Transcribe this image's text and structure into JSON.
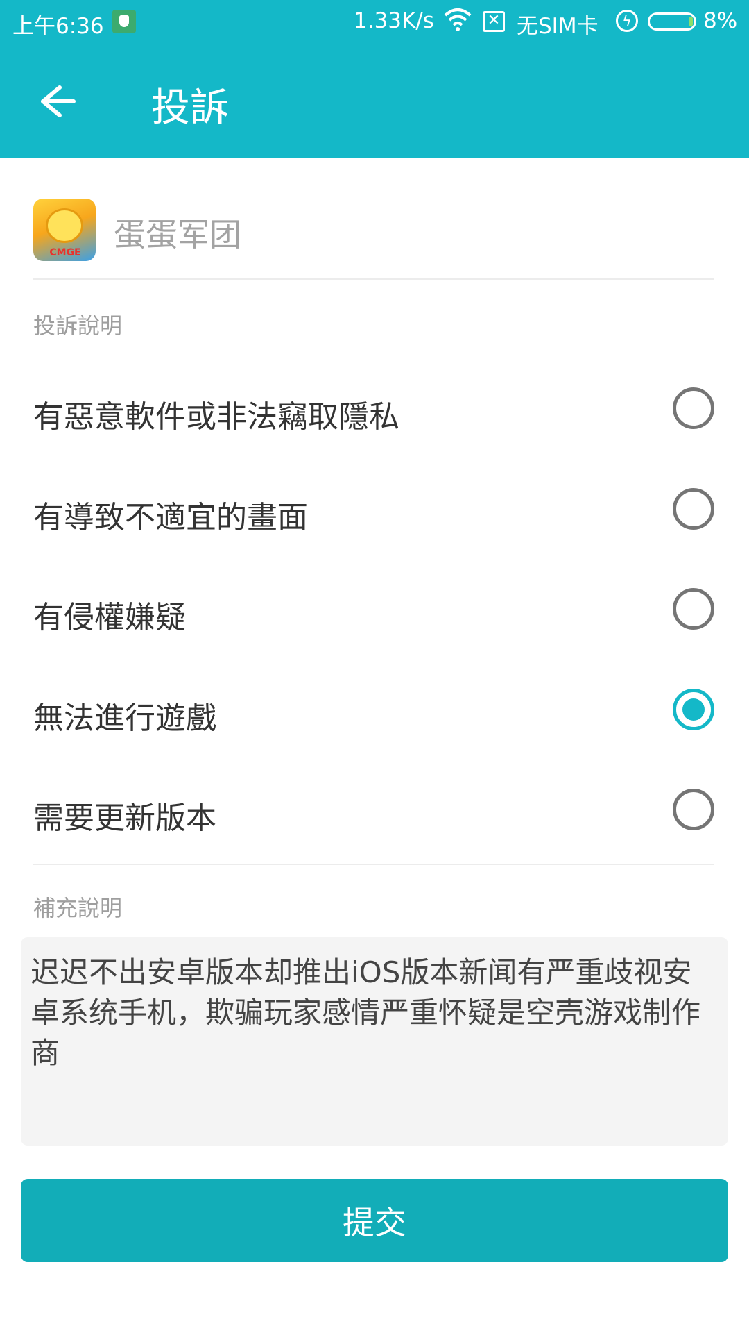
{
  "status_bar": {
    "time": "上午6:36",
    "net_speed": "1.33K/s",
    "wifi_icon": "wifi-icon",
    "sim_text": "无SIM卡",
    "battery_pct": "8%",
    "battery_color": "#8ce06a"
  },
  "app_bar": {
    "title": "投訴",
    "back_icon": "arrow-left-icon",
    "color": "#14b8c8"
  },
  "app": {
    "name": "蛋蛋军团",
    "icon_brand": "CMGE"
  },
  "complaint": {
    "section_label": "投訴說明",
    "options": [
      {
        "label": "有惡意軟件或非法竊取隱私",
        "checked": false
      },
      {
        "label": "有導致不適宜的畫面",
        "checked": false
      },
      {
        "label": "有侵權嫌疑",
        "checked": false
      },
      {
        "label": "無法進行遊戲",
        "checked": true
      },
      {
        "label": "需要更新版本",
        "checked": false
      }
    ]
  },
  "supplement": {
    "section_label": "補充說明",
    "text": "迟迟不出安卓版本却推出iOS版本新闻有严重歧视安卓系统手机，欺骗玩家感情严重怀疑是空壳游戏制作商"
  },
  "submit": {
    "label": "提交",
    "color": "#12adb8"
  }
}
